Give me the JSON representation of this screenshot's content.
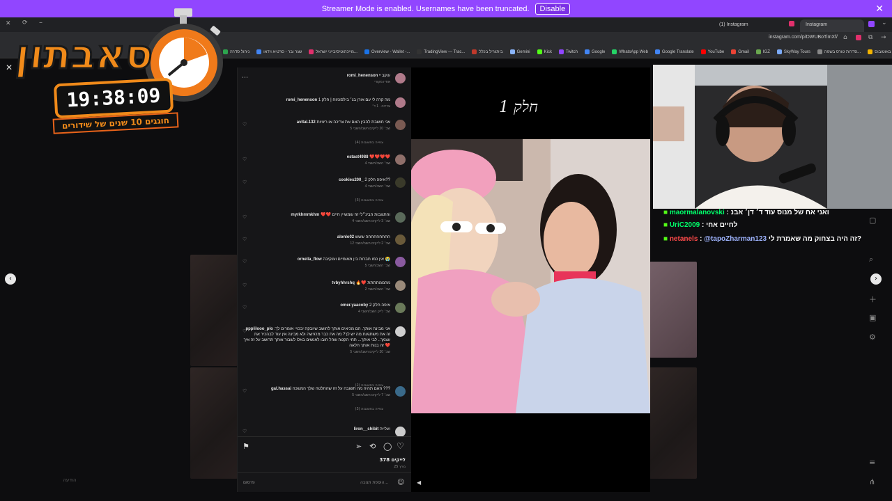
{
  "banner": {
    "text": "Streamer Mode is enabled. Usernames have been truncated.",
    "button": "Disable"
  },
  "browser": {
    "tabs": [
      {
        "label": "(1) Instagram"
      },
      {
        "label": "Instagram"
      }
    ],
    "url": "instagram.com/p/DWUBoTimXf/",
    "bookmarks": [
      "ניהול סדרה",
      "שגר ובר - סרטיא וידאו",
      "מייכהוטיסיבייני ישראל...",
      "Overview - Wallet -...",
      "TradingView — Trac...",
      "ביתגריל בכלל",
      "Gemini",
      "Kick",
      "Twitch",
      "Google",
      "WhatsApp Web",
      "Google Translate",
      "YouTube",
      "Gmail",
      "IGZ",
      "SkyWay Tours",
      "סדרות טורס בשפה...",
      "באוטובוס",
      "כללי"
    ]
  },
  "overlay": {
    "logo_text": "סאבתון",
    "timer": "19:38:09",
    "tagline": "חוגגים 10 שנים של שידורים"
  },
  "comments": [
    {
      "user": "romi_henenson",
      "text": "• עוקב",
      "meta": "אודיו מקורי",
      "avatar_color": "#b07a8a"
    },
    {
      "user": "romi_henenson",
      "text": "מה קרה לי עם אורן בג׳ בילסונזוח | חלק 1",
      "meta": "עריכה · 1 ד׳",
      "avatar_color": "#b07a8a"
    },
    {
      "user": "avital.132",
      "text": "אני חושבת להבין האם את צריכה או ריציות",
      "meta": "5 שב׳  20 לייקים  השב/השבי",
      "avatar_color": "#7a5a52",
      "replies": "צפייה בתשובות (4)"
    },
    {
      "user": "estast4988",
      "text": "❤️❤️❤️❤️",
      "meta": "4 שב׳  השב/השבי",
      "avatar_color": "#8f6f6a"
    },
    {
      "user": "cookies200_",
      "text": "איפה חלק 2??",
      "meta": "4 שב׳  השב/השבי",
      "avatar_color": "#3a3a2a",
      "replies": "צפייה בתשובות (3)"
    },
    {
      "user": "myrkhmmkhm",
      "text": "❤️❤️ והתגובות הבינ״לי זה שמשיין חיים",
      "meta": "4 שב׳  3 לייקים  השב/השבי",
      "avatar_color": "#5a6a5a"
    },
    {
      "user": "alonlo02",
      "text": "חחחחחחחחה ששש",
      "meta": "12 שב׳  2 לייקים  השב/השבי",
      "avatar_color": "#6a5a3a"
    },
    {
      "user": "ornella_flow",
      "text": "אין כמו חברות בין מאומיים וענקיבה 😭",
      "meta": "5 שב׳  השב/השבי",
      "avatar_color": "#8a5aa0"
    },
    {
      "user": "tvbyhhrshq",
      "text": "🔥❤️ מהממתתתת",
      "meta": "2 שב׳  השב/השבי",
      "avatar_color": "#9a8a7a"
    },
    {
      "user": "omer.yaacoby",
      "text": "איפה חלק 2",
      "meta": "4 שב׳  לייק  השב/השבי",
      "avatar_color": "#6a7a5a"
    },
    {
      "user": "ppplilooo_plo",
      "text": "אני מבינה אותך. הם מכיאים אותך לחושב שיובקה יבכויי אומרים לך: זה את משתגעת מה יש לך? מה את כבר מרגישה ולא מבינה אין עוד לבהכיר את עצמך.. לבי איתך... תחי הקטה שהל חובו לאנשים באלו לשבור אותך תרושב על זה איך זה בנות אותך חלאה ❤️",
      "meta": "5 שב׳  30 לייקים  השב/השבי",
      "avatar_color": "#cfcfcf",
      "replies": "צפייה בתשובות (2)"
    },
    {
      "user": "gal.hassai",
      "text": "האם תהיה מה תשובה על זה שהחלטה שלך המשכה ???",
      "meta": "5 שב׳  7 לייקים  השב/השבי",
      "avatar_color": "#3a6a8a",
      "replies": "צפייה בתשובות (3)"
    },
    {
      "user": "liron__shibit",
      "text": "ועלייה",
      "meta": "",
      "avatar_color": "#cccccc"
    }
  ],
  "actions": {
    "likes": "378 לייקים",
    "date": "25 מרץ",
    "comment_placeholder": "הוספת תגובה...",
    "post_button": "פרסום"
  },
  "post": {
    "caption": "חלק 1"
  },
  "chat": [
    {
      "user": "maormalanovski",
      "user_color": "#00ff6a",
      "message": "ואני אח של מנוס עוד ד׳ דן׳ אבנ",
      "text_color": "#ffffff"
    },
    {
      "user": "UriC2009",
      "user_color": "#00ff6a",
      "message": "לחיים אחי",
      "text_color": "#ffffff"
    },
    {
      "user": "netanels",
      "user_color": "#ff4a4a",
      "mention": "@tapoZharman123",
      "message": "זה היה בצחוק מה שאמרת לי?",
      "text_color": "#ffffff"
    }
  ],
  "side_bottom": {
    "label": "הודעה"
  }
}
